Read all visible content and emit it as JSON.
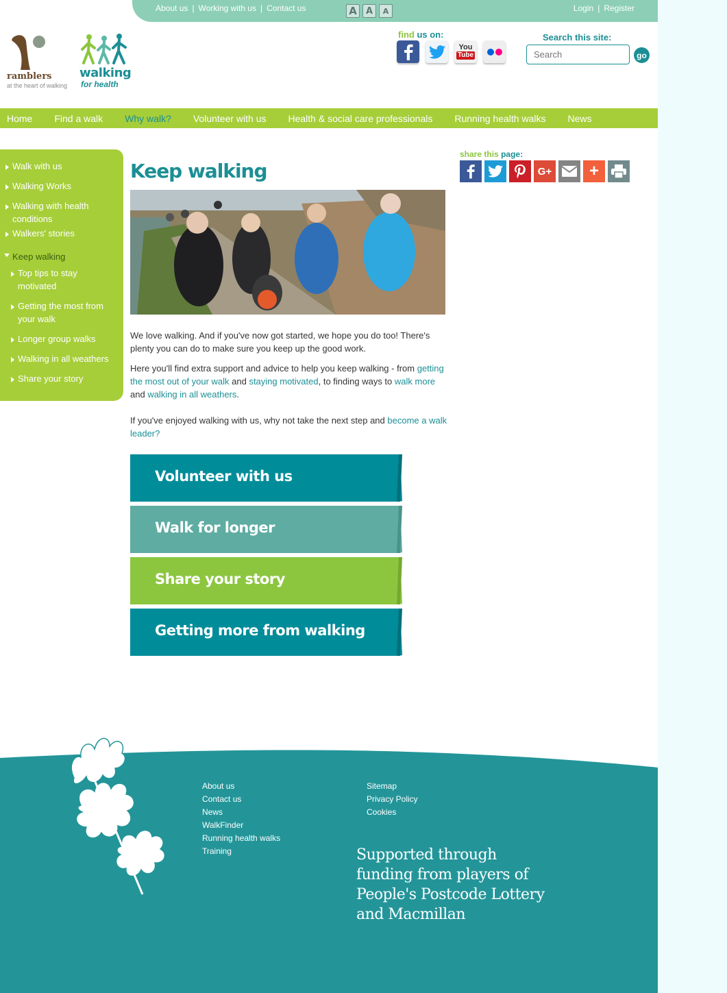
{
  "utility": {
    "links": [
      "About us",
      "Working with us",
      "Contact us"
    ],
    "font_sizes": [
      "A",
      "A",
      "A"
    ],
    "login": "Login",
    "register": "Register"
  },
  "logos": {
    "ramblers_name": "ramblers",
    "ramblers_tag": "at the heart of walking",
    "wfh_name": "walking",
    "wfh_sub": "for health"
  },
  "social": {
    "find": "find",
    "us_on": "us on:",
    "icons": [
      "facebook-icon",
      "twitter-icon",
      "youtube-icon",
      "flickr-icon"
    ],
    "youtube_top": "You",
    "youtube_bottom": "Tube"
  },
  "search": {
    "label": "Search this site:",
    "placeholder": "Search",
    "go": "go"
  },
  "nav": [
    "Home",
    "Find a walk",
    "Why walk?",
    "Volunteer with us",
    "Health & social care professionals",
    "Running health walks",
    "News"
  ],
  "nav_active": "Why walk?",
  "sidebar": {
    "items": [
      "Walk with us",
      "Walking Works",
      "Walking with health conditions",
      "Walkers' stories",
      "Keep walking"
    ],
    "subitems": [
      "Top tips to stay motivated",
      "Getting the most from your walk",
      "Longer group walks",
      "Walking in all weathers",
      "Share your story"
    ]
  },
  "content": {
    "title": "Keep walking",
    "p1": "We love walking. And if you've now got started, we hope you do too! There's plenty you can do to make sure you keep up the good work.",
    "p2_a": "Here you'll find extra support and advice to help you keep walking - from ",
    "p2_link1": "getting the most out of your walk",
    "p2_b": " and ",
    "p2_link2": "staying motivated",
    "p2_c": ", to finding ways to ",
    "p2_link3": "walk more",
    "p2_d": " and ",
    "p2_link4": "walking in all weathers",
    "p2_e": ".",
    "p3_a": "If you've enjoyed walking with us, why not take the next step and ",
    "p3_link": "become a walk leader?"
  },
  "banners": [
    {
      "label": "Volunteer with us",
      "color": "#008c99"
    },
    {
      "label": "Walk for longer",
      "color": "#5eaca2"
    },
    {
      "label": "Share your story",
      "color": "#8cc63f"
    },
    {
      "label": "Getting more from walking",
      "color": "#008c99"
    }
  ],
  "share": {
    "share": "share",
    "this": "this",
    "page": "page:",
    "icons": [
      "facebook-icon",
      "twitter-icon",
      "pinterest-icon",
      "google-plus-icon",
      "email-icon",
      "plus-icon",
      "print-icon"
    ]
  },
  "footer": {
    "col1": [
      "About us",
      "Contact us",
      "News",
      "WalkFinder",
      "Running health walks",
      "Training"
    ],
    "col2": [
      "Sitemap",
      "Privacy Policy",
      "Cookies"
    ],
    "supported": "Supported through funding from players of People's Postcode Lottery and Macmillan"
  },
  "colors": {
    "teal": "#1b8f95",
    "green": "#a6ce39",
    "mint": "#8ccfb6",
    "footer": "#239599"
  }
}
